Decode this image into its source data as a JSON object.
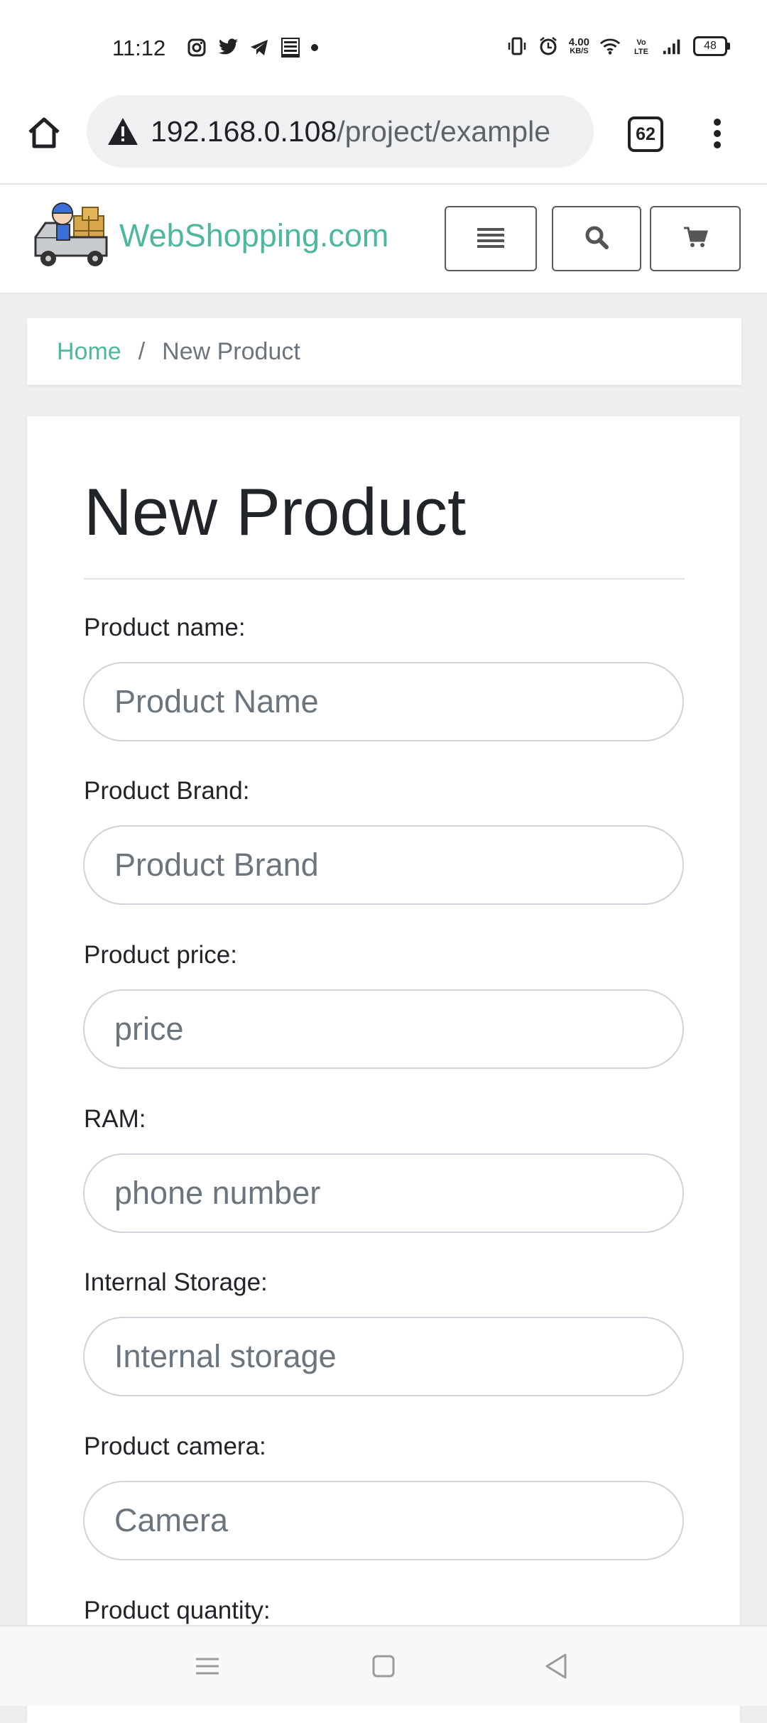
{
  "status_bar": {
    "time": "11:12",
    "net_speed_value": "4.00",
    "net_speed_unit": "KB/S",
    "battery": "48"
  },
  "browser": {
    "url_host": "192.168.0.108",
    "url_path": "/project/example",
    "tab_count": "62"
  },
  "site": {
    "brand": "WebShopping.com",
    "accent_color": "#4db89e"
  },
  "breadcrumb": {
    "home": "Home",
    "separator": "/",
    "current": "New Product"
  },
  "form": {
    "title": "New Product",
    "fields": [
      {
        "label": "Product name:",
        "placeholder": "Product Name"
      },
      {
        "label": "Product Brand:",
        "placeholder": "Product Brand"
      },
      {
        "label": "Product price:",
        "placeholder": "price"
      },
      {
        "label": "RAM:",
        "placeholder": "phone number"
      },
      {
        "label": "Internal Storage:",
        "placeholder": "Internal storage"
      },
      {
        "label": "Product camera:",
        "placeholder": "Camera"
      },
      {
        "label": "Product quantity:",
        "placeholder": ""
      }
    ]
  }
}
